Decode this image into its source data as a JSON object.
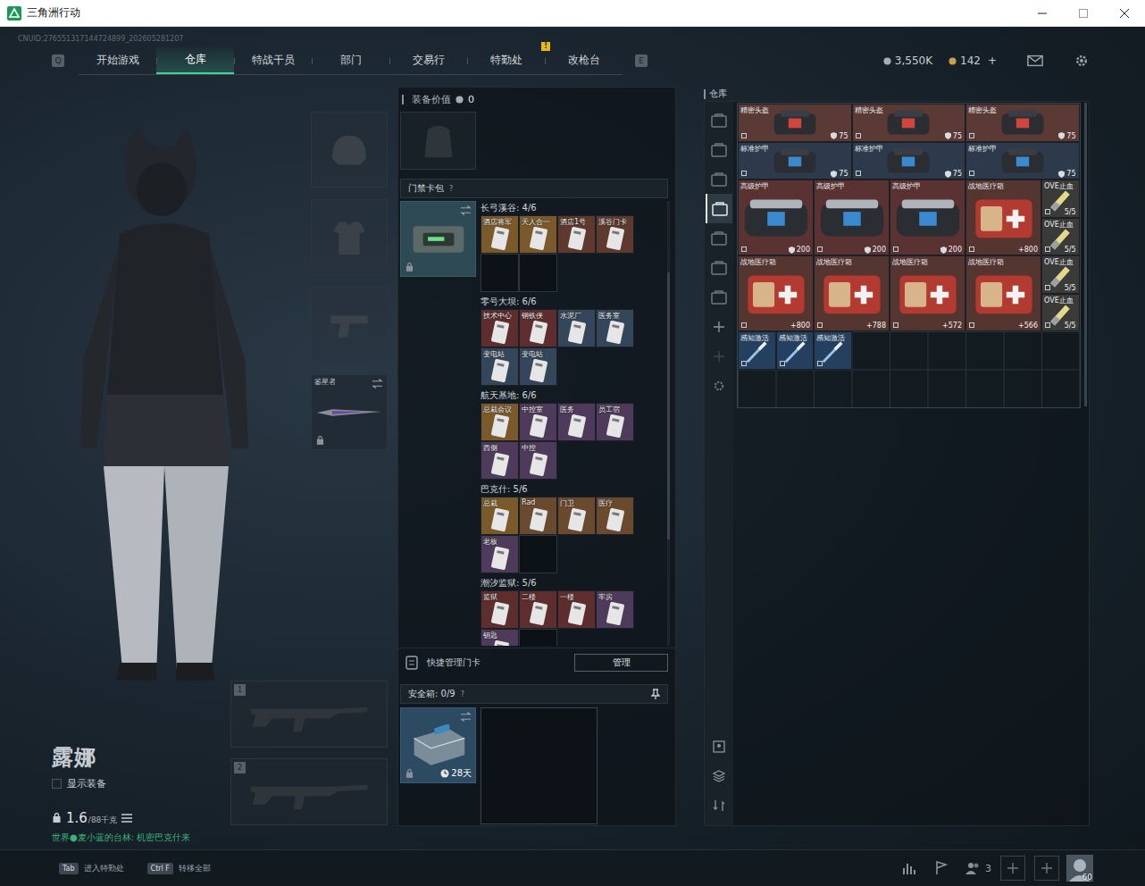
{
  "window": {
    "title": "三角洲行动"
  },
  "uid": "CNUID:276551317144724899_202605281207",
  "nav": {
    "prev_key": "Q",
    "next_key": "E",
    "badge_mark": "!",
    "tabs": [
      {
        "label": "开始游戏",
        "selected": false,
        "badge": false
      },
      {
        "label": "仓库",
        "selected": true,
        "badge": false
      },
      {
        "label": "特战干员",
        "selected": false,
        "badge": false
      },
      {
        "label": "部门",
        "selected": false,
        "badge": false
      },
      {
        "label": "交易行",
        "selected": false,
        "badge": false
      },
      {
        "label": "特勤处",
        "selected": false,
        "badge": true
      },
      {
        "label": "改枪台",
        "selected": false,
        "badge": false
      }
    ]
  },
  "currency": [
    {
      "kind": "silver",
      "value": "3,550K"
    },
    {
      "kind": "gold",
      "value": "142",
      "plus": "+"
    }
  ],
  "operator": {
    "name": "露娜",
    "show_equipment": {
      "label": "显示装备",
      "checked": false
    },
    "weight": "1.6",
    "weight_max": "/88千克",
    "status": "世界●麦小蓝的台林: 机密巴克什来"
  },
  "gear_slots": [
    {
      "kind": "helmet",
      "filled": false,
      "locked": false
    },
    {
      "kind": "armor",
      "filled": false,
      "locked": false
    },
    {
      "kind": "pistol",
      "filled": false,
      "locked": false
    },
    {
      "kind": "melee",
      "filled": true,
      "locked": true,
      "label": "鉴星者"
    }
  ],
  "weapon_slots": [
    {
      "number": "1"
    },
    {
      "number": "2"
    }
  ],
  "loadout": {
    "value_label": "装备价值",
    "value": "0",
    "card_case": {
      "title": "门禁卡包",
      "help": "?",
      "locked": true,
      "maps": [
        {
          "label": "长弓溪谷: 4/6",
          "slots": 6,
          "cards": [
            {
              "name": "酒店将军",
              "color": "#7a5a2a"
            },
            {
              "name": "天人合一",
              "color": "#7a5a2a"
            },
            {
              "name": "酒店1号",
              "color": "#5e3a2e"
            },
            {
              "name": "溪谷门卡",
              "color": "#5e3a2e"
            }
          ]
        },
        {
          "label": "零号大坝: 6/6",
          "slots": 6,
          "cards": [
            {
              "name": "技术中心",
              "color": "#5e2e2e"
            },
            {
              "name": "钢铁侠",
              "color": "#5e2e2e"
            },
            {
              "name": "水泥厂",
              "color": "#34465a"
            },
            {
              "name": "医务室",
              "color": "#34465a"
            },
            {
              "name": "变电站",
              "color": "#34465a"
            },
            {
              "name": "变电站",
              "color": "#34465a"
            }
          ]
        },
        {
          "label": "航天基地: 6/6",
          "slots": 6,
          "cards": [
            {
              "name": "总裁会议",
              "color": "#7a5a2a"
            },
            {
              "name": "中控室",
              "color": "#4e3a5a"
            },
            {
              "name": "医务",
              "color": "#4e3a5a"
            },
            {
              "name": "员工宿",
              "color": "#4e3a5a"
            },
            {
              "name": "西侧",
              "color": "#4e3a5a"
            },
            {
              "name": "中控",
              "color": "#4e3a5a"
            }
          ]
        },
        {
          "label": "巴克什: 5/6",
          "slots": 6,
          "cards": [
            {
              "name": "总裁",
              "color": "#7a5a2a"
            },
            {
              "name": "Rad",
              "color": "#6a4a2e"
            },
            {
              "name": "门卫",
              "color": "#6a4a2e"
            },
            {
              "name": "医疗",
              "color": "#6a4a2e"
            },
            {
              "name": "老板",
              "color": "#4e3a5a"
            }
          ]
        },
        {
          "label": "潮汐监狱: 5/6",
          "slots": 6,
          "cards": [
            {
              "name": "监狱",
              "color": "#5e2e2e"
            },
            {
              "name": "二楼",
              "color": "#5e2e2e"
            },
            {
              "name": "一楼",
              "color": "#5e2e2e"
            },
            {
              "name": "牢房",
              "color": "#4e3a5a"
            },
            {
              "name": "钥匙",
              "color": "#4e3a5a"
            }
          ]
        }
      ]
    },
    "quick_manage": {
      "label": "快捷管理门卡",
      "button": "管理"
    },
    "safe_box": {
      "title": "安全箱: 0/9",
      "help": "?",
      "timer": "28天",
      "locked": true,
      "slots": 9
    }
  },
  "warehouse": {
    "title": "仓库",
    "tabs": [
      {
        "selected": false
      },
      {
        "selected": false
      },
      {
        "selected": false
      },
      {
        "selected": true
      },
      {
        "selected": false
      },
      {
        "selected": false
      },
      {
        "selected": false
      }
    ],
    "items": [
      {
        "name": "精密头盔",
        "kind": "helmet",
        "color": "#5b3934",
        "value": "75"
      },
      {
        "name": "精密头盔",
        "kind": "helmet",
        "color": "#5b3934",
        "value": "75"
      },
      {
        "name": "精密头盔",
        "kind": "helmet",
        "color": "#5b3934",
        "value": "75"
      },
      {
        "name": "标准护甲",
        "kind": "armor",
        "color": "#2c3a4b",
        "value": "75"
      },
      {
        "name": "标准护甲",
        "kind": "armor",
        "color": "#2c3a4b",
        "value": "75"
      },
      {
        "name": "标准护甲",
        "kind": "armor",
        "color": "#2c3a4b",
        "value": "75"
      },
      {
        "name": "高级护甲",
        "kind": "vest",
        "color": "#5a3232",
        "value": "200"
      },
      {
        "name": "高级护甲",
        "kind": "vest",
        "color": "#5a3232",
        "value": "200"
      },
      {
        "name": "高级护甲",
        "kind": "vest",
        "color": "#5a3232",
        "value": "200"
      },
      {
        "name": "战地医疗箱",
        "kind": "medkit",
        "color": "#553530",
        "value": "+800"
      },
      {
        "name": "OVE止血",
        "kind": "bandage",
        "color": "#3a3a38",
        "value": "5/5"
      },
      {
        "name": "OVE止血",
        "kind": "bandage",
        "color": "#3a3a38",
        "value": "5/5"
      },
      {
        "name": "战地医疗箱",
        "kind": "medkit",
        "color": "#553530",
        "value": "+800"
      },
      {
        "name": "战地医疗箱",
        "kind": "medkit",
        "color": "#553530",
        "value": "+788"
      },
      {
        "name": "战地医疗箱",
        "kind": "medkit",
        "color": "#553530",
        "value": "+572"
      },
      {
        "name": "战地医疗箱",
        "kind": "medkit",
        "color": "#553530",
        "value": "+566"
      },
      {
        "name": "OVE止血",
        "kind": "bandage",
        "color": "#3a3a38",
        "value": "5/5"
      },
      {
        "name": "OVE止血",
        "kind": "bandage",
        "color": "#3a3a38",
        "value": "5/5"
      },
      {
        "name": "感知激活",
        "kind": "injector",
        "color": "#24405e"
      },
      {
        "name": "感知激活",
        "kind": "injector",
        "color": "#24405e"
      },
      {
        "name": "感知激活",
        "kind": "injector",
        "color": "#24405e"
      }
    ]
  },
  "footer": {
    "hints": [
      {
        "key": "Tab",
        "label": "进入特勤处"
      },
      {
        "key": "Ctrl F",
        "label": "转移全部"
      }
    ],
    "friends": "3",
    "level": "60"
  }
}
